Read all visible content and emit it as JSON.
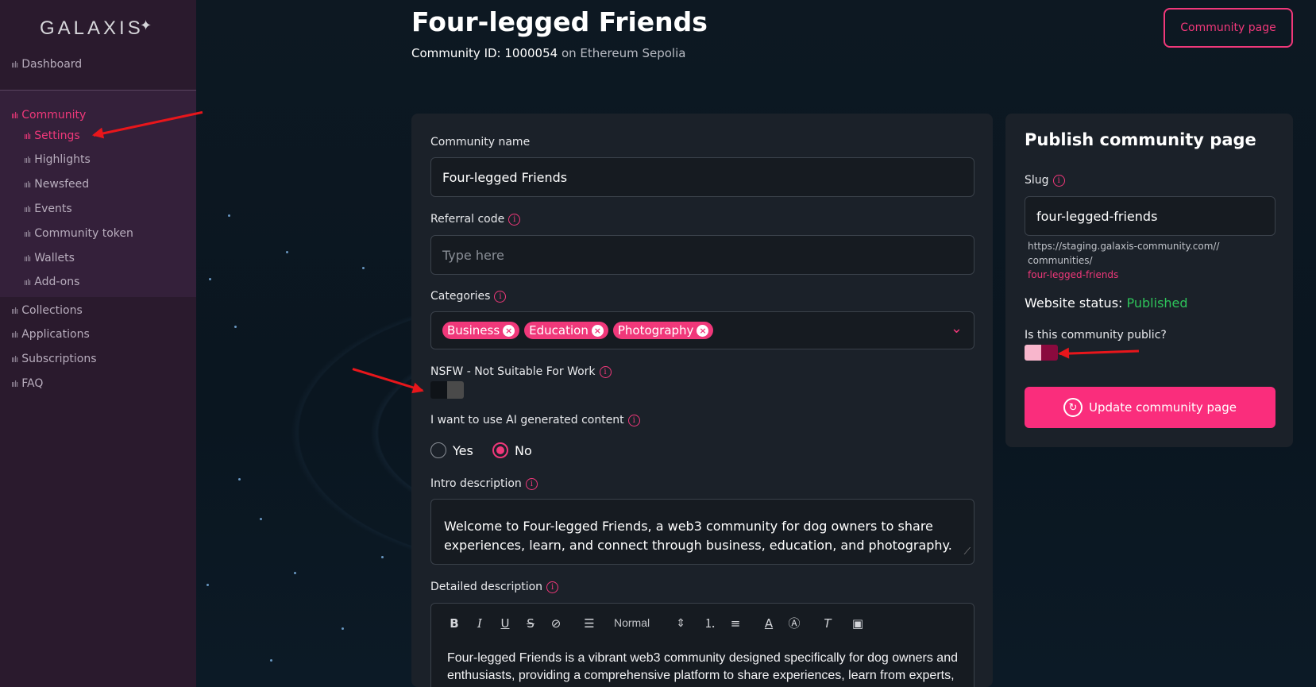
{
  "brand": {
    "name": "GALAXIS",
    "accent": "#f0387a"
  },
  "sidebar": {
    "items": [
      {
        "label": "Dashboard"
      },
      {
        "label": "Community"
      },
      {
        "label": "Settings"
      },
      {
        "label": "Highlights"
      },
      {
        "label": "Newsfeed"
      },
      {
        "label": "Events"
      },
      {
        "label": "Community token"
      },
      {
        "label": "Wallets"
      },
      {
        "label": "Add-ons"
      },
      {
        "label": "Collections"
      },
      {
        "label": "Applications"
      },
      {
        "label": "Subscriptions"
      },
      {
        "label": "FAQ"
      }
    ]
  },
  "header": {
    "title": "Four-legged Friends",
    "community_id_label": "Community ID: 1000054",
    "network": "on Ethereum Sepolia",
    "community_page_button": "Community page"
  },
  "form": {
    "community_name": {
      "label": "Community name",
      "value": "Four-legged Friends"
    },
    "referral_code": {
      "label": "Referral code",
      "placeholder": "Type here"
    },
    "categories": {
      "label": "Categories",
      "tags": [
        "Business",
        "Education",
        "Photography"
      ]
    },
    "nsfw": {
      "label": "NSFW - Not Suitable For Work",
      "enabled": false
    },
    "ai_content": {
      "label": "I want to use AI generated content",
      "options": [
        "Yes",
        "No"
      ],
      "selected": "No"
    },
    "intro_description": {
      "label": "Intro description",
      "value": "Welcome to Four-legged Friends, a web3 community for dog owners to share experiences, learn, and connect through business, education, and photography."
    },
    "detailed_description": {
      "label": "Detailed description",
      "toolbar": {
        "heading_select": "Normal"
      },
      "value": "Four-legged Friends is a vibrant web3 community designed specifically for dog owners and enthusiasts, providing a comprehensive platform to share experiences, learn from experts,"
    }
  },
  "publish": {
    "title": "Publish community page",
    "slug_label": "Slug",
    "slug_value": "four-legged-friends",
    "url_line1": "https://staging.galaxis-community.com//",
    "url_line2": "communities/",
    "url_line3": "four-legged-friends",
    "status_label": "Website status:",
    "status_value": "Published",
    "status_color": "#2ec45a",
    "public_label": "Is this community public?",
    "public_enabled": true,
    "update_button": "Update community page"
  }
}
